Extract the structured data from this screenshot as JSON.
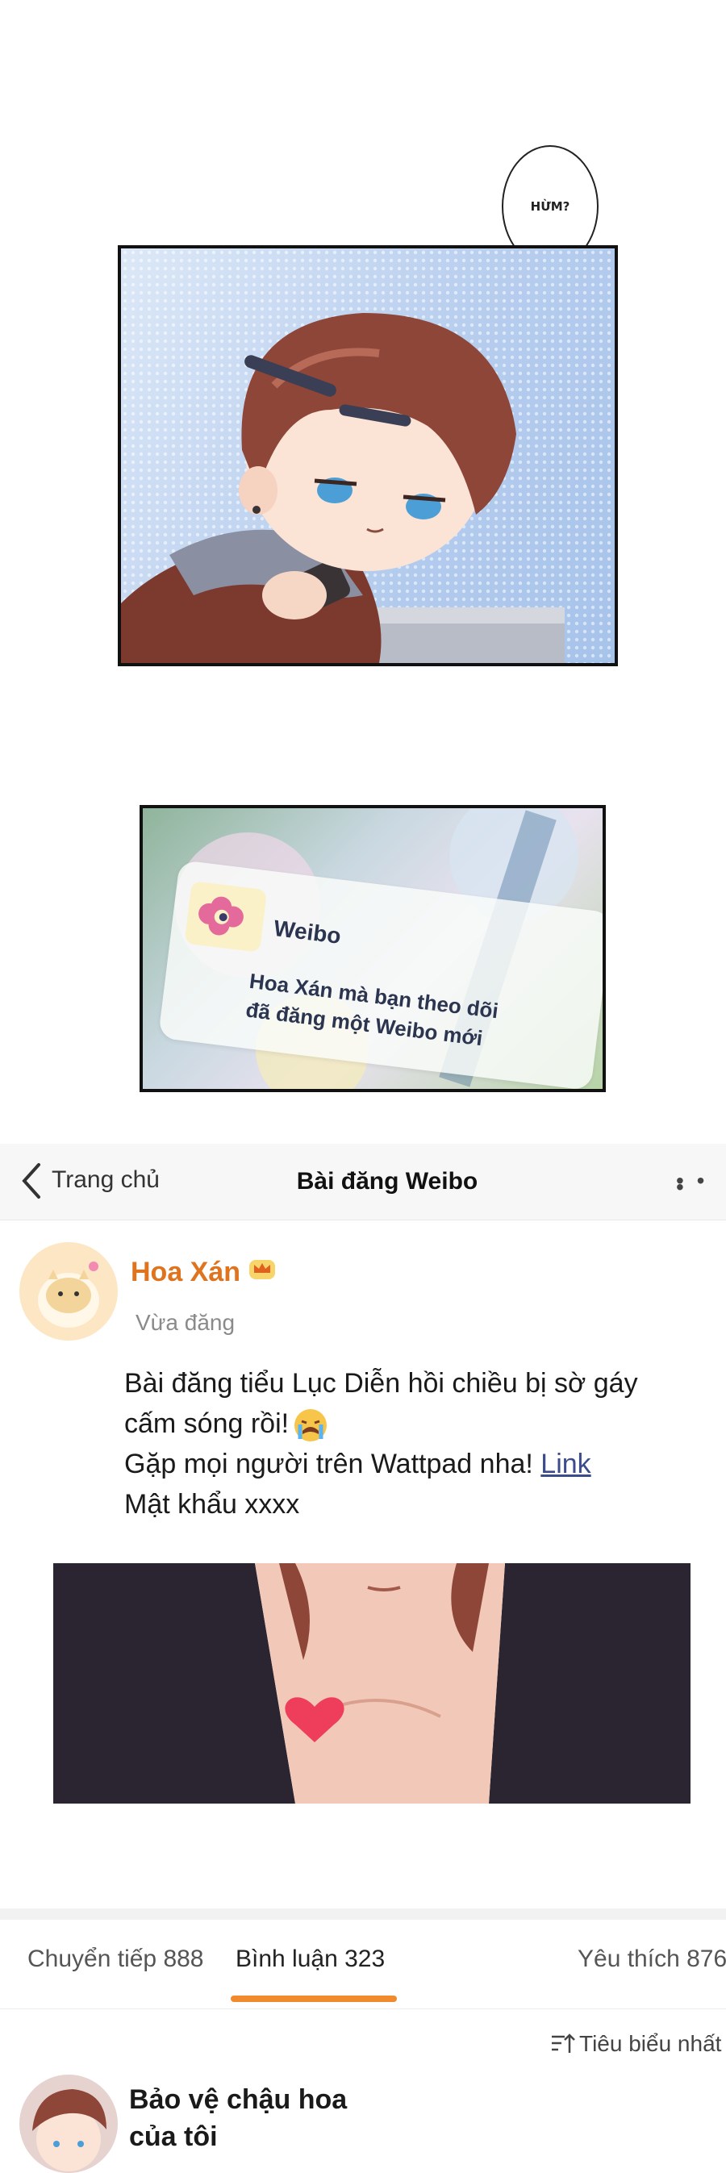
{
  "comic": {
    "speech_bubble": "HỪM?",
    "notification": {
      "app": "Weibo",
      "body": "Hoa Xán mà bạn theo dõi\nđã đăng một Weibo mới"
    }
  },
  "header": {
    "back_label": "Trang chủ",
    "title": "Bài đăng Weibo",
    "more": "• • •"
  },
  "post": {
    "author": "Hoa Xán",
    "time": "Vừa đăng",
    "line1": "Bài đăng tiểu Lục Diễn hồi chiều bị sờ gáy",
    "line2": "cấm sóng rồi!",
    "line3_prefix": "Gặp mọi người trên Wattpad nha!",
    "link": "Link",
    "line4": "Mật khẩu xxxx"
  },
  "tabs": [
    {
      "label": "Chuyển tiếp 888"
    },
    {
      "label": "Bình luận 323"
    },
    {
      "label": "Yêu thích 876"
    }
  ],
  "sort": {
    "label": "Tiêu biểu nhất"
  },
  "comment": {
    "author": "Bảo vệ chậu hoa của tôi"
  },
  "colors": {
    "accent": "#f08a2c",
    "author_name": "#e0731d",
    "link": "#3c4b8c"
  }
}
